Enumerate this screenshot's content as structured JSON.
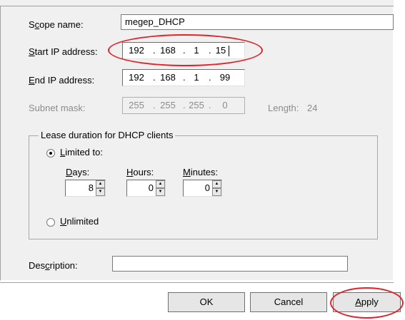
{
  "form": {
    "scope_label_pre": "S",
    "scope_label_ul": "c",
    "scope_label_post": "ope name:",
    "scope_value": "megep_DHCP",
    "start_label_ul": "S",
    "start_label_post": "tart IP address:",
    "start_ip": [
      "192",
      "168",
      "1",
      "15"
    ],
    "end_label_ul": "E",
    "end_label_post": "nd IP address:",
    "end_ip": [
      "192",
      "168",
      "1",
      "99"
    ],
    "mask_label": "Subnet mask:",
    "mask_ip": [
      "255",
      "255",
      "255",
      "0"
    ],
    "length_label": "Length:",
    "length_value": "24",
    "ip_separator": "."
  },
  "lease": {
    "group_title": "Lease duration for DHCP clients",
    "limited_ul": "L",
    "limited_post": "imited to:",
    "days_ul": "D",
    "days_post": "ays:",
    "days_value": "8",
    "hours_ul": "H",
    "hours_post": "ours:",
    "hours_value": "0",
    "minutes_ul": "M",
    "minutes_post": "inutes:",
    "minutes_value": "0",
    "unlimited_ul": "U",
    "unlimited_post": "nlimited",
    "selected": "limited"
  },
  "description": {
    "label_pre": "Des",
    "label_ul": "c",
    "label_post": "ription:",
    "value": ""
  },
  "buttons": {
    "ok": "OK",
    "cancel": "Cancel",
    "apply_ul": "A",
    "apply_post": "pply"
  },
  "colors": {
    "panel": "#f0f0f0",
    "highlight_ellipse": "#e0242b"
  }
}
